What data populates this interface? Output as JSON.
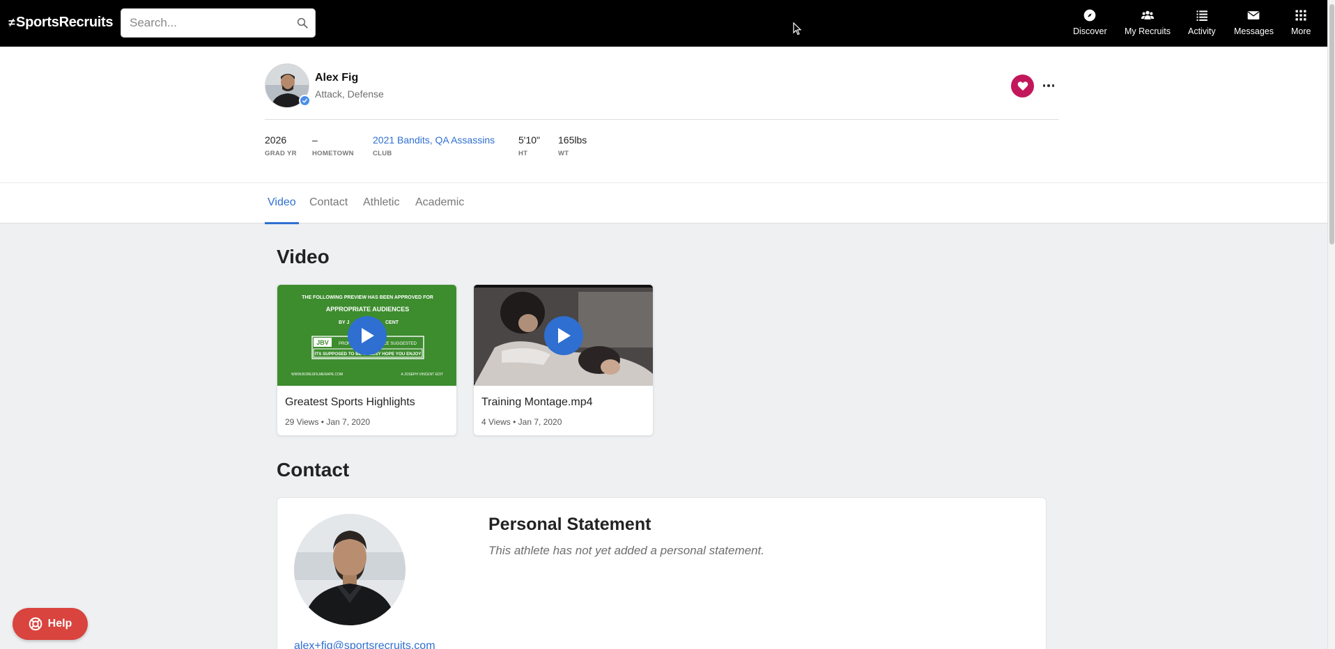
{
  "app": {
    "logo_text": "SportsRecruits",
    "logo_mark": "≠"
  },
  "search": {
    "placeholder": "Search..."
  },
  "nav": {
    "items": [
      {
        "label": "Discover",
        "icon": "compass-icon"
      },
      {
        "label": "My Recruits",
        "icon": "people-icon"
      },
      {
        "label": "Activity",
        "icon": "list-icon"
      },
      {
        "label": "Messages",
        "icon": "envelope-icon"
      },
      {
        "label": "More",
        "icon": "grid-icon"
      }
    ]
  },
  "profile": {
    "name": "Alex Fig",
    "positions": "Attack, Defense",
    "stats": [
      {
        "value": "2026",
        "label": "GRAD YR"
      },
      {
        "value": "–",
        "label": "HOMETOWN"
      },
      {
        "value": "2021 Bandits, QA Assassins",
        "label": "CLUB"
      },
      {
        "value": "5'10\"",
        "label": "HT"
      },
      {
        "value": "165lbs",
        "label": "WT"
      }
    ]
  },
  "tabs": [
    {
      "label": "Video",
      "active": true
    },
    {
      "label": "Contact",
      "active": false
    },
    {
      "label": "Athletic",
      "active": false
    },
    {
      "label": "Academic",
      "active": false
    }
  ],
  "video_section": {
    "title": "Video",
    "videos": [
      {
        "title": "Greatest Sports Highlights",
        "meta": "29 Views • Jan 7, 2020",
        "thumb_line1": "THE FOLLOWING PREVIEW HAS BEEN APPROVED FOR",
        "thumb_line2": "APPROPRIATE AUDIENCES",
        "thumb_line3": "BY J",
        "thumb_line3b": "CENT",
        "thumb_badge": "JBV",
        "thumb_rating1": "PROF",
        "thumb_rating1b": "NCE SUGGESTED",
        "thumb_rating2": "ITS SUPPOSED TO BE CHEESY HOPE YOU ENJOY",
        "thumb_footer_left": "WWW.BORESFILMERAPE.COM",
        "thumb_footer_right": "A JOSEPH VINCENT EDIT"
      },
      {
        "title": "Training Montage.mp4",
        "meta": "4 Views • Jan 7, 2020"
      }
    ]
  },
  "contact_section": {
    "title": "Contact",
    "personal_statement_title": "Personal Statement",
    "personal_statement_text": "This athlete has not yet added a personal statement.",
    "email": "alex+fig@sportsrecruits.com"
  },
  "help": {
    "label": "Help"
  },
  "colors": {
    "accent": "#2e6fd1",
    "favorite": "#c2185b",
    "help": "#d9443e",
    "topbar": "#000000"
  }
}
